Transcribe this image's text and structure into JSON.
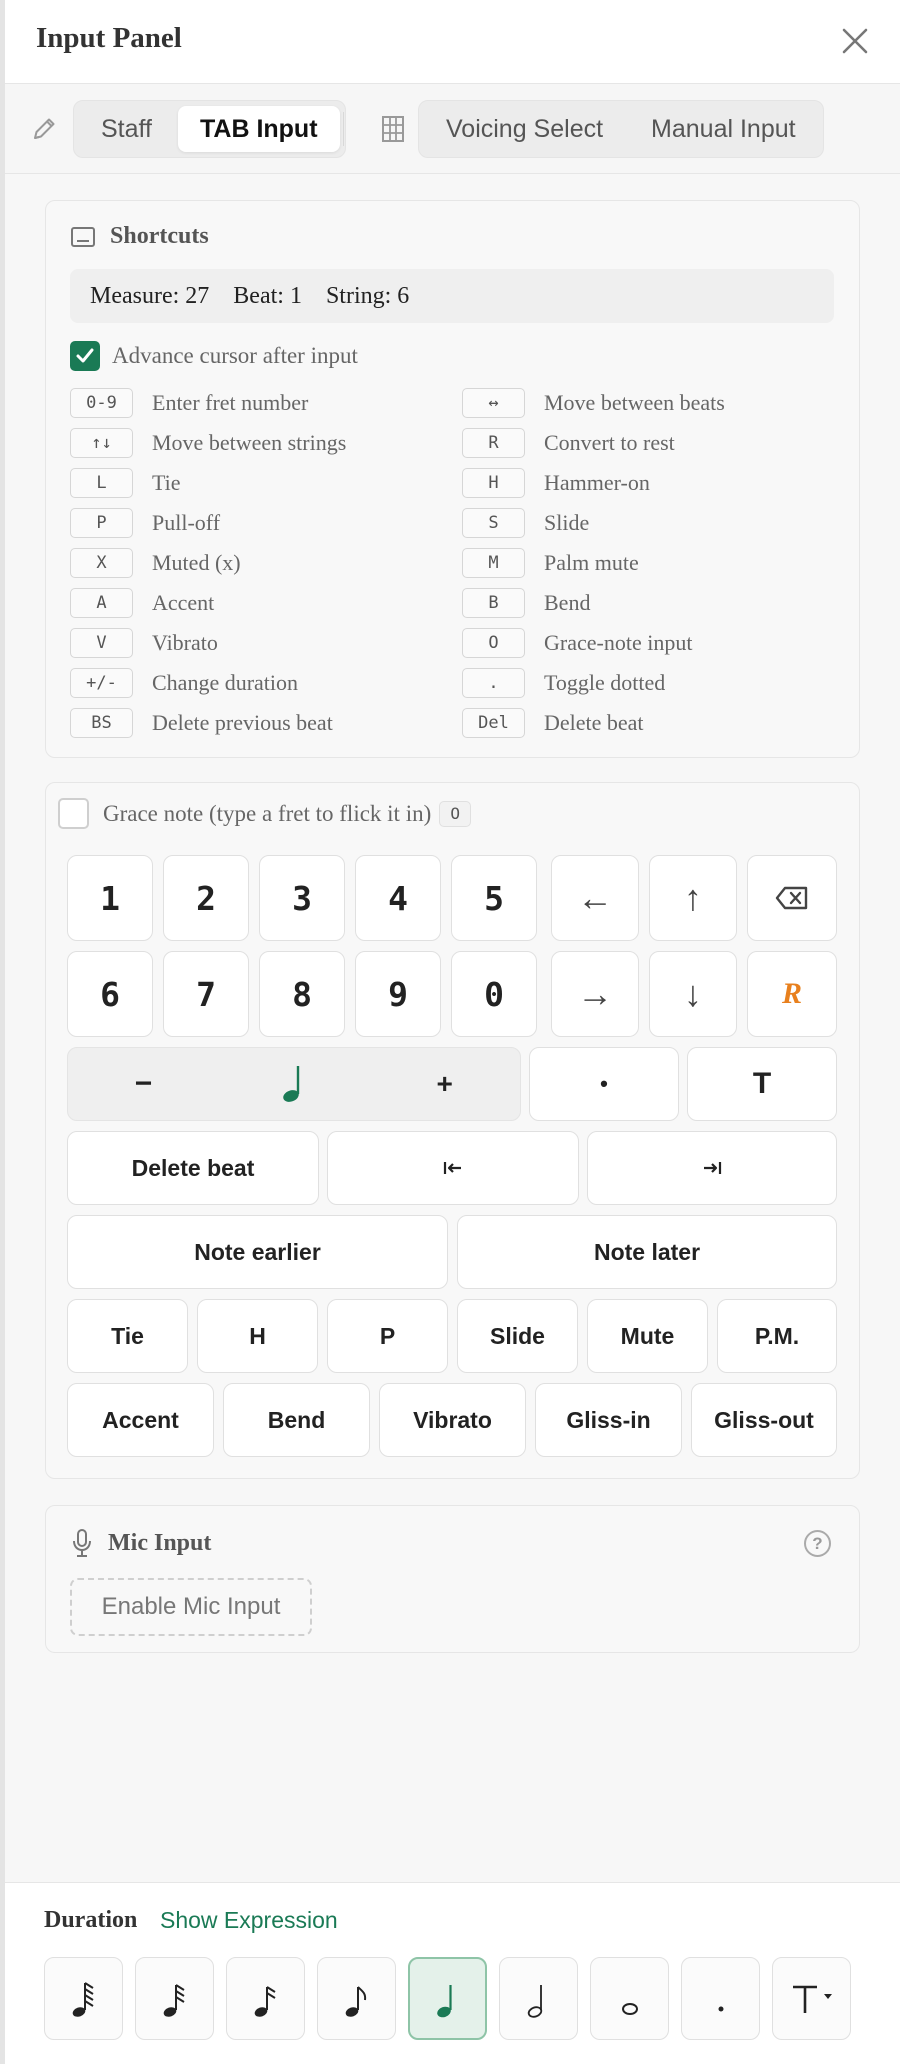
{
  "header": {
    "title": "Input Panel"
  },
  "tabs": {
    "mode": [
      "Staff",
      "TAB Input"
    ],
    "active_mode": "TAB Input",
    "entry": [
      "Voicing Select",
      "Manual Input"
    ]
  },
  "shortcuts": {
    "title": "Shortcuts",
    "measure": "Measure: 27",
    "beat": "Beat: 1",
    "string": "String: 6",
    "advance_label": "Advance cursor after input",
    "advance_checked": true,
    "keys": [
      {
        "key": "0-9",
        "desc": "Enter fret number"
      },
      {
        "key": "↔",
        "desc": "Move between beats"
      },
      {
        "key": "↑↓",
        "desc": "Move between strings"
      },
      {
        "key": "R",
        "desc": "Convert to rest"
      },
      {
        "key": "L",
        "desc": "Tie"
      },
      {
        "key": "H",
        "desc": "Hammer-on"
      },
      {
        "key": "P",
        "desc": "Pull-off"
      },
      {
        "key": "S",
        "desc": "Slide"
      },
      {
        "key": "X",
        "desc": "Muted (x)"
      },
      {
        "key": "M",
        "desc": "Palm mute"
      },
      {
        "key": "A",
        "desc": "Accent"
      },
      {
        "key": "B",
        "desc": "Bend"
      },
      {
        "key": "V",
        "desc": "Vibrato"
      },
      {
        "key": "O",
        "desc": "Grace-note input"
      },
      {
        "key": "+/-",
        "desc": "Change duration"
      },
      {
        "key": ".",
        "desc": "Toggle dotted"
      },
      {
        "key": "BS",
        "desc": "Delete previous beat"
      },
      {
        "key": "Del",
        "desc": "Delete beat"
      }
    ]
  },
  "keypad": {
    "grace_label": "Grace note (type a fret to flick it in)",
    "grace_key": "O",
    "grace_checked": false,
    "row1": [
      "1",
      "2",
      "3",
      "4",
      "5"
    ],
    "row2": [
      "6",
      "7",
      "8",
      "9",
      "0"
    ],
    "arrow_left": "←",
    "arrow_up": "↑",
    "arrow_right": "→",
    "arrow_down": "↓",
    "rest": "R",
    "dur_minus": "−",
    "dur_plus": "+",
    "dot": "•",
    "tie_symbol": "T",
    "delete_beat": "Delete beat",
    "note_earlier": "Note earlier",
    "note_later": "Note later",
    "techniques": [
      "Tie",
      "H",
      "P",
      "Slide",
      "Mute",
      "P.M."
    ],
    "effects": [
      "Accent",
      "Bend",
      "Vibrato",
      "Gliss-in",
      "Gliss-out"
    ]
  },
  "mic": {
    "title": "Mic Input",
    "help": "?",
    "enable": "Enable Mic Input"
  },
  "duration": {
    "title": "Duration",
    "show_expression": "Show Expression",
    "options": [
      "64th",
      "32nd",
      "16th",
      "8th",
      "quarter",
      "half",
      "whole",
      "dot",
      "tuplet"
    ],
    "selected": "quarter",
    "accent_color": "#1a7a55"
  }
}
